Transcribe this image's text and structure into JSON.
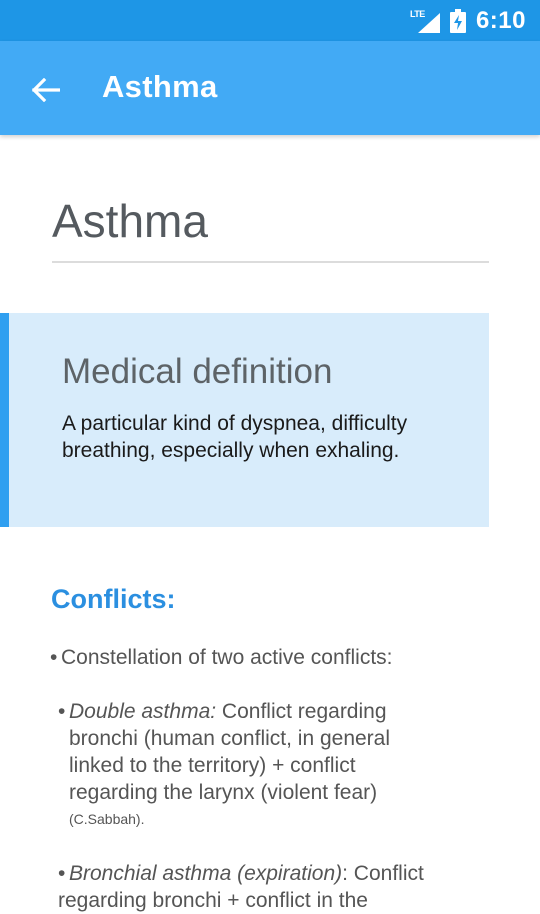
{
  "status_bar": {
    "network": "LTE",
    "time": "6:10"
  },
  "app_bar": {
    "title": "Asthma"
  },
  "page": {
    "title": "Asthma"
  },
  "definition_card": {
    "heading": "Medical definition",
    "text": "A particular kind of dyspnea, difficulty breathing, especially when exhaling."
  },
  "conflicts": {
    "heading": "Conflicts:",
    "intro": "Constellation of two active conflicts:",
    "double_label": "Double asthma:",
    "double_line1": " Conflict regarding",
    "double_line2": "bronchi (human conflict, in general",
    "double_line3": "linked to the territory) + conflict",
    "double_line4": "regarding the larynx (violent fear)",
    "double_citation": "(C.Sabbah).",
    "bronchial_label": "Bronchial asthma (expiration)",
    "bronchial_text": ": Conflict regarding bronchi + conflict in the"
  },
  "colors": {
    "status_bar": "#1e96e6",
    "app_bar": "#42aaf5",
    "card_background": "#d8ecfb",
    "card_accent": "#2f9ff0",
    "conflicts_heading": "#2b8fe0"
  },
  "icons": {
    "back": "arrow-left-icon",
    "signal": "signal-icon",
    "battery": "battery-charging-icon"
  }
}
